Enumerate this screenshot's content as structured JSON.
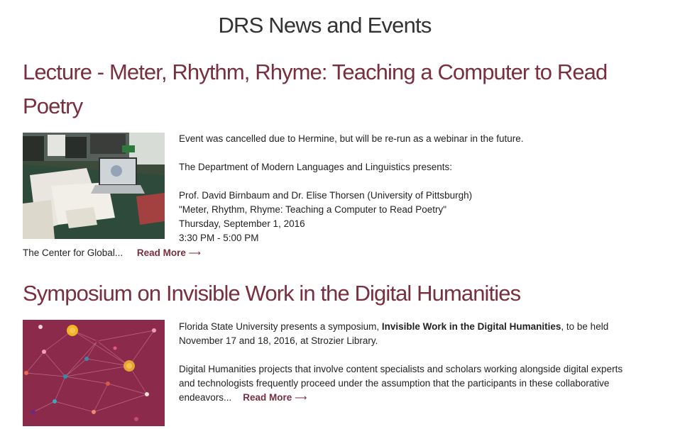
{
  "page": {
    "title": "DRS News and Events"
  },
  "posts": [
    {
      "title_line1": "Lecture - Meter, Rhythm, Rhyme: Teaching a Computer to Read",
      "title_line2": "Poetry",
      "image_icon": "desk-with-laptop-photo",
      "paragraphs": [
        "Event was cancelled due to Hermine, but will be re-run as a webinar in the future.",
        "The Department of Modern Languages and Linguistics presents:"
      ],
      "details": [
        "Prof. David Birnbaum and Dr. Elise Thorsen (University of Pittsburgh)",
        "\"Meter, Rhythm, Rhyme: Teaching a Computer to Read Poetry\"",
        "Thursday, September 1, 2016",
        "3:30 PM - 5:00 PM"
      ],
      "excerpt_tail": "The Center for Global...",
      "read_more": "Read More",
      "arrow": "⟶"
    },
    {
      "title": "Symposium on Invisible Work in the Digital Humanities",
      "image_icon": "network-graph-image",
      "intro_before": "Florida State University presents a symposium, ",
      "intro_bold": "Invisible Work in the Digital Humanities",
      "intro_after": ", to be held November 17 and 18, 2016, at Strozier Library.",
      "excerpt": "Digital Humanities projects that involve content specialists and scholars working alongside digital experts and technologists frequently proceed under the assumption that the participants in these collaborative endeavors...",
      "read_more": "Read More",
      "arrow": "⟶"
    }
  ],
  "colors": {
    "title": "#782f40",
    "network_bg": "#8b2a4a"
  }
}
